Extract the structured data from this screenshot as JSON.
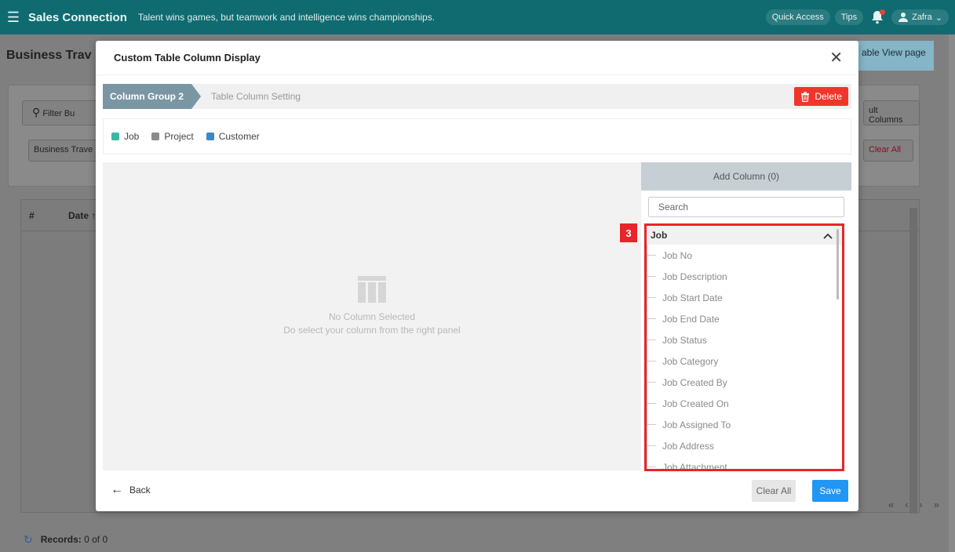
{
  "topbar": {
    "app_name": "Sales Connection",
    "tagline": "Talent wins games, but teamwork and intelligence wins championships.",
    "quick_access_label": "Quick Access",
    "tips_label": "Tips",
    "user_name": "Zafra"
  },
  "background": {
    "page_title": "Business Trav",
    "table_view_label": "able View page",
    "filter_placeholder": "Filter Bu",
    "default_columns_label": "ult Columns",
    "chip_label": "Business Trave",
    "clear_all_label": "Clear All",
    "table_headers": [
      "#",
      "Date ↑"
    ],
    "records_label": "Records:",
    "records_value": "0  of  0",
    "pager": [
      "«",
      "‹",
      "›",
      "»"
    ]
  },
  "modal": {
    "title": "Custom Table Column Display",
    "steps": {
      "active": "Column Group 2",
      "next": "Table Column Setting"
    },
    "delete_label": "Delete",
    "legend": [
      {
        "label": "Job",
        "color": "#3bb8a4"
      },
      {
        "label": "Project",
        "color": "#8c8c8c"
      },
      {
        "label": "Customer",
        "color": "#3a88c8"
      }
    ],
    "empty_state": {
      "line1": "No Column Selected",
      "line2": "Do select your column from the right panel"
    },
    "panel": {
      "header": "Add Column (0)",
      "search_placeholder": "Search",
      "annotation_badge": "3",
      "group": "Job",
      "items": [
        "Job No",
        "Job Description",
        "Job Start Date",
        "Job End Date",
        "Job Status",
        "Job Category",
        "Job Created By",
        "Job Created On",
        "Job Assigned To",
        "Job Address",
        "Job Attachment"
      ]
    },
    "back_label": "Back",
    "clear_all_label": "Clear All",
    "save_label": "Save"
  }
}
